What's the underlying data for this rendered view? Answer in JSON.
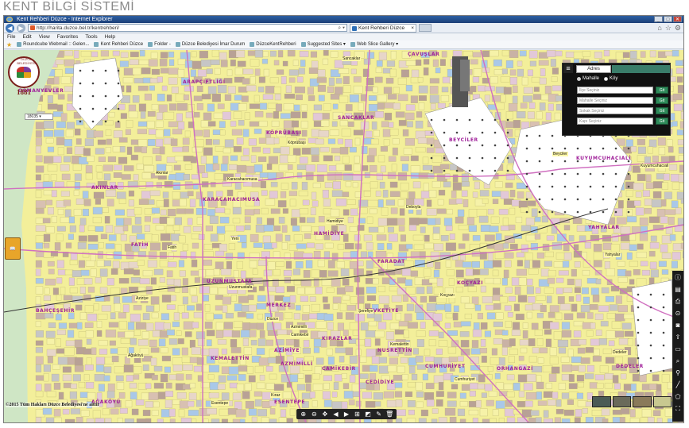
{
  "page": {
    "title": "KENT BİLGİ SİSTEMİ"
  },
  "browser": {
    "window_title": "Kent Rehberi Düzce - Internet Explorer",
    "url": "http://harita.duzce.bel.tr/kentrehberi/",
    "tab_label": "Kent Rehberi Düzce",
    "menu": [
      "File",
      "Edit",
      "View",
      "Favorites",
      "Tools",
      "Help"
    ],
    "favorites": [
      "Roundcube Webmail :: Gelen...",
      "Kent Rehberi Düzce",
      "Folder -",
      "Düzce Belediyesi İmar Durum",
      "DüzceKentRehberi",
      "Suggested Sites ▾",
      "Web Slice Gallery ▾"
    ]
  },
  "logo": {
    "name": "DÜZCE BELEDİYESİ",
    "year": "1881"
  },
  "scale": {
    "value": "18035"
  },
  "search_panel": {
    "tab_address": "Adres",
    "radio_mahalle": "Mahalle",
    "radio_koy": "Köy",
    "fields": [
      "İlçe Seçiniz",
      "Mahalle Seçiniz",
      "Sokak Seçiniz",
      "Kapı Seçiniz"
    ],
    "go_label": "Git"
  },
  "districts": [
    "OSMANYEVLER",
    "ARAPÇİFTLİĞİ",
    "ÇAVUŞLAR",
    "SANCAKLAR",
    "KÖPRÜBAŞI",
    "BEYCİLER",
    "KUYUMCUHACIALİ",
    "AKINLAR",
    "KARACAHACIMUSA",
    "FATİH",
    "HAMİDİYE",
    "FARADAT",
    "UZUNMUSTAFA",
    "KOÇYAZI",
    "CEDİDİYE",
    "YAHYALAR",
    "MERKEZ",
    "AZİMİYE",
    "NUSRETTİN",
    "CUMHURİYET",
    "ŞEVKETİYE",
    "KEMALETTİN",
    "DEDELER",
    "ORHANGAZİ",
    "AĞAKÖYÜ",
    "ESENTEPE",
    "KIRAZLAR",
    "AZMİMİLLİ",
    "CAMİKEBİR",
    "BAHÇEŞEHİR"
  ],
  "pois": [
    "Köprübaşı",
    "Kuyumcuhacıali",
    "Akınlar",
    "Karacahacımusa",
    "Yeni",
    "Fatih",
    "Hamidiye",
    "Uzunmustafa",
    "Camikebir",
    "Düzce",
    "Şerefiye",
    "Kemalettin",
    "Azmimilli",
    "Aziziye",
    "Esentepe",
    "Kıraz",
    "Ağaköyü",
    "Beyciler",
    "Yahyalar",
    "Koçyazı",
    "Dedeler",
    "Cumhuriyet",
    "Sancaklar",
    "Deboyla"
  ],
  "tools": {
    "right": [
      "info-icon",
      "layers-icon",
      "print-icon",
      "locate-icon",
      "camera-icon",
      "upload-icon",
      "folder-icon",
      "search-icon",
      "pin-icon",
      "ruler-icon",
      "polygon-icon",
      "fullscreen-icon"
    ]
  },
  "copyright": "©2015 Tüm Hakları Düzce Belediyesi'ne aittir"
}
